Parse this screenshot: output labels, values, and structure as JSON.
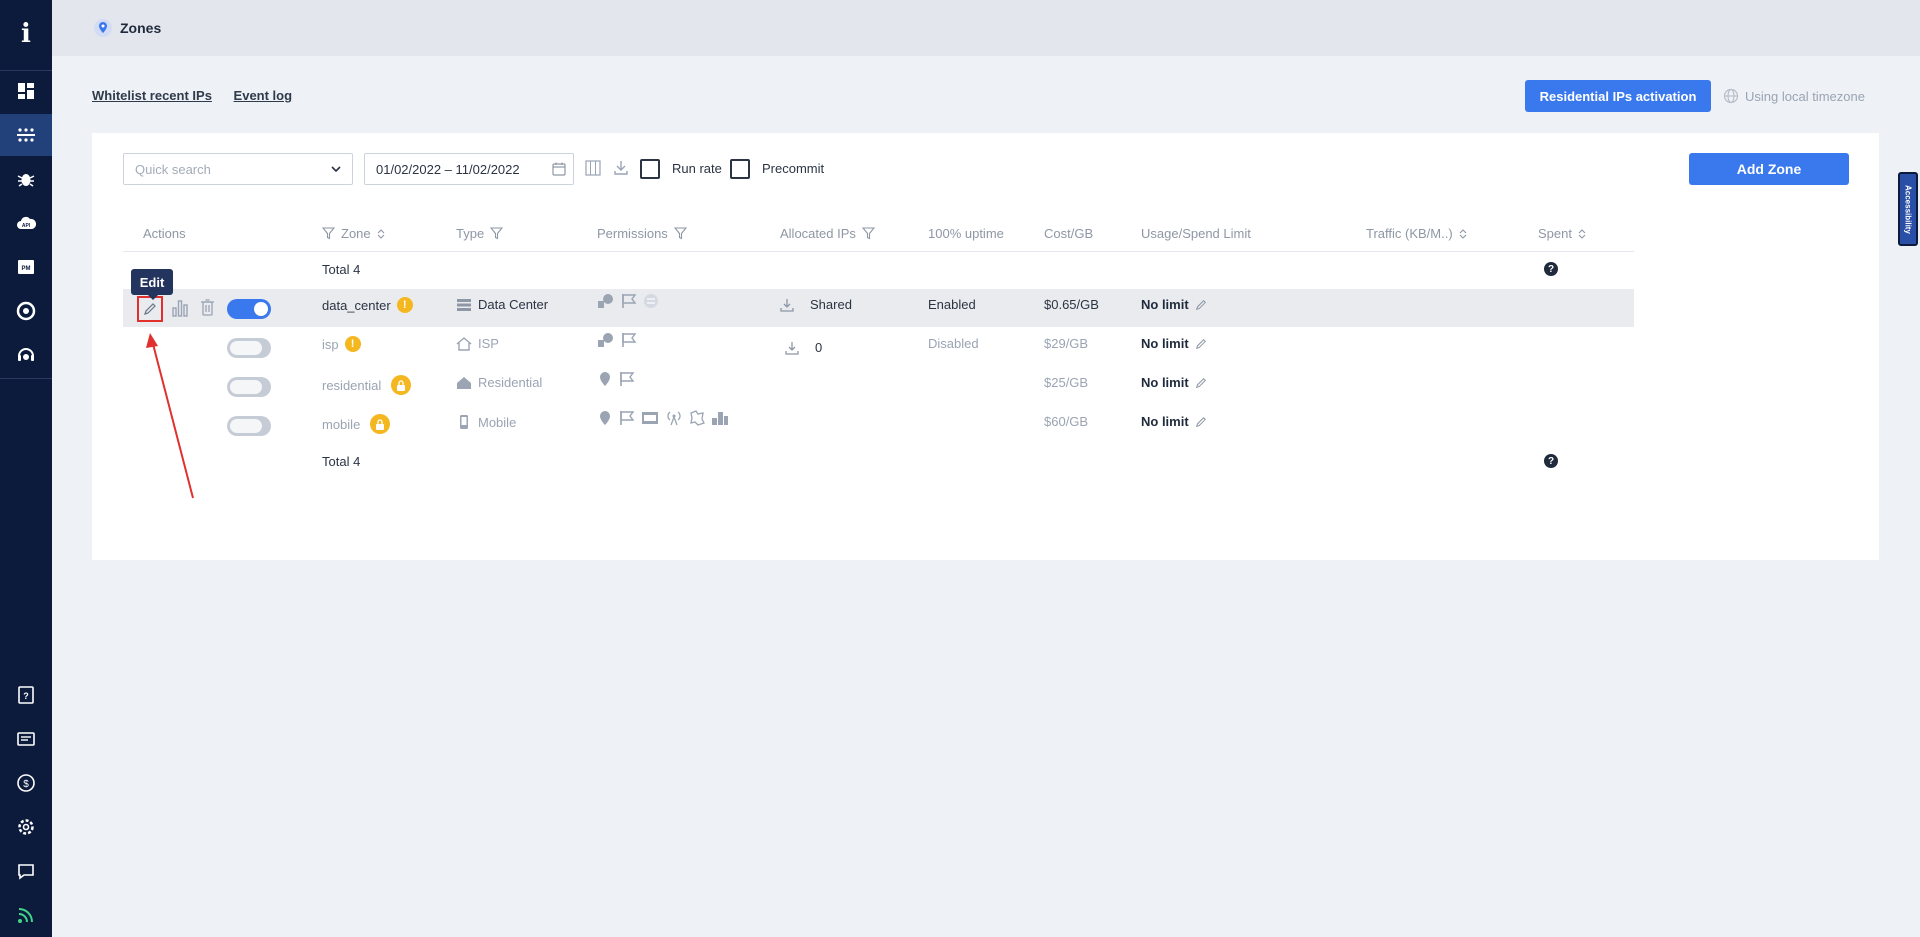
{
  "sidebar": {
    "logo": "i",
    "items": [
      {
        "name": "dashboard-icon"
      },
      {
        "name": "zones-icon",
        "active": true
      },
      {
        "name": "bug-icon"
      },
      {
        "name": "api-cloud-icon",
        "label": "API"
      },
      {
        "name": "proxy-manager-icon",
        "label": "PM"
      },
      {
        "name": "chrome-icon"
      },
      {
        "name": "support-24-icon"
      }
    ],
    "bottom_items": [
      {
        "name": "help-book-icon"
      },
      {
        "name": "billing-icon"
      },
      {
        "name": "dollar-icon"
      },
      {
        "name": "settings-icon"
      },
      {
        "name": "chat-icon"
      },
      {
        "name": "rss-icon"
      }
    ]
  },
  "header": {
    "title": "Zones"
  },
  "links": {
    "whitelist": "Whitelist recent IPs",
    "event_log": "Event log"
  },
  "actions": {
    "activation": "Residential IPs activation",
    "timezone": "Using local timezone"
  },
  "toolbar": {
    "search_placeholder": "Quick search",
    "date_range": "01/02/2022 – 11/02/2022",
    "run_rate": "Run rate",
    "precommit": "Precommit",
    "add_zone": "Add Zone"
  },
  "accessibility_label": "Accessibility",
  "table": {
    "headers": {
      "actions": "Actions",
      "zone": "Zone",
      "type": "Type",
      "permissions": "Permissions",
      "allocated_ips": "Allocated IPs",
      "uptime": "100% uptime",
      "cost": "Cost/GB",
      "usage": "Usage/Spend Limit",
      "traffic": "Traffic (KB/M..)",
      "spent": "Spent"
    },
    "total_top": "Total 4",
    "total_bottom": "Total 4",
    "rows": [
      {
        "zone": "data_center",
        "type": "Data Center",
        "allocated": "Shared",
        "uptime": "Enabled",
        "cost": "$0.65/GB",
        "limit": "No limit",
        "enabled": true
      },
      {
        "zone": "isp",
        "type": "ISP",
        "allocated": "0",
        "uptime": "Disabled",
        "cost": "$29/GB",
        "limit": "No limit",
        "enabled": false
      },
      {
        "zone": "residential",
        "type": "Residential",
        "allocated": "",
        "uptime": "",
        "cost": "$25/GB",
        "limit": "No limit",
        "enabled": false
      },
      {
        "zone": "mobile",
        "type": "Mobile",
        "allocated": "",
        "uptime": "",
        "cost": "$60/GB",
        "limit": "No limit",
        "enabled": false
      }
    ]
  },
  "tooltip": "Edit",
  "colors": {
    "primary": "#3a78ee",
    "sidebar": "#0c1b3c",
    "warning": "#f5b720",
    "annotation": "#e0312e"
  }
}
